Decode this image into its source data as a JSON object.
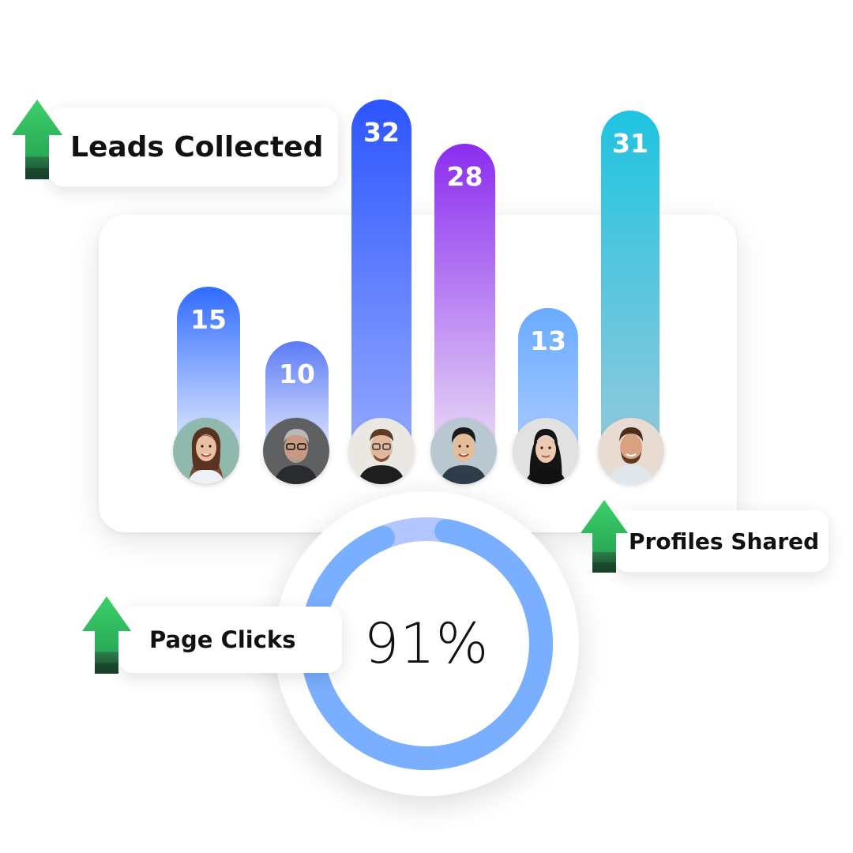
{
  "chart_data": [
    {
      "type": "bar",
      "values": [
        15,
        10,
        32,
        28,
        13,
        31
      ],
      "bar_colors": [
        [
          "#2f6bff",
          "#e6ecff"
        ],
        [
          "#5b7bf5",
          "#e3e8ff"
        ],
        [
          "#2d55ff",
          "#93a8ff"
        ],
        [
          "#8b2cf0",
          "#e8d9f6"
        ],
        [
          "#6aaaff",
          "#a9ccff"
        ],
        [
          "#1ec4e0",
          "#93c8dc"
        ]
      ],
      "categories_avatar_icons": [
        "woman-avatar-icon",
        "older-man-avatar-icon",
        "man-glasses-avatar-icon",
        "man-avatar-icon",
        "asian-woman-avatar-icon",
        "bearded-man-avatar-icon"
      ]
    },
    {
      "type": "pie",
      "value_percent": 91,
      "label": "91%",
      "ring_color": "#7aaeff",
      "ring_light_color": "#b3c6ff"
    }
  ],
  "badges": {
    "leads": "Leads Collected",
    "profiles": "Profiles Shared",
    "clicks": "Page Clicks"
  },
  "colors": {
    "arrow_green": "#2fbe5a",
    "arrow_dark": "#1e5d36"
  }
}
